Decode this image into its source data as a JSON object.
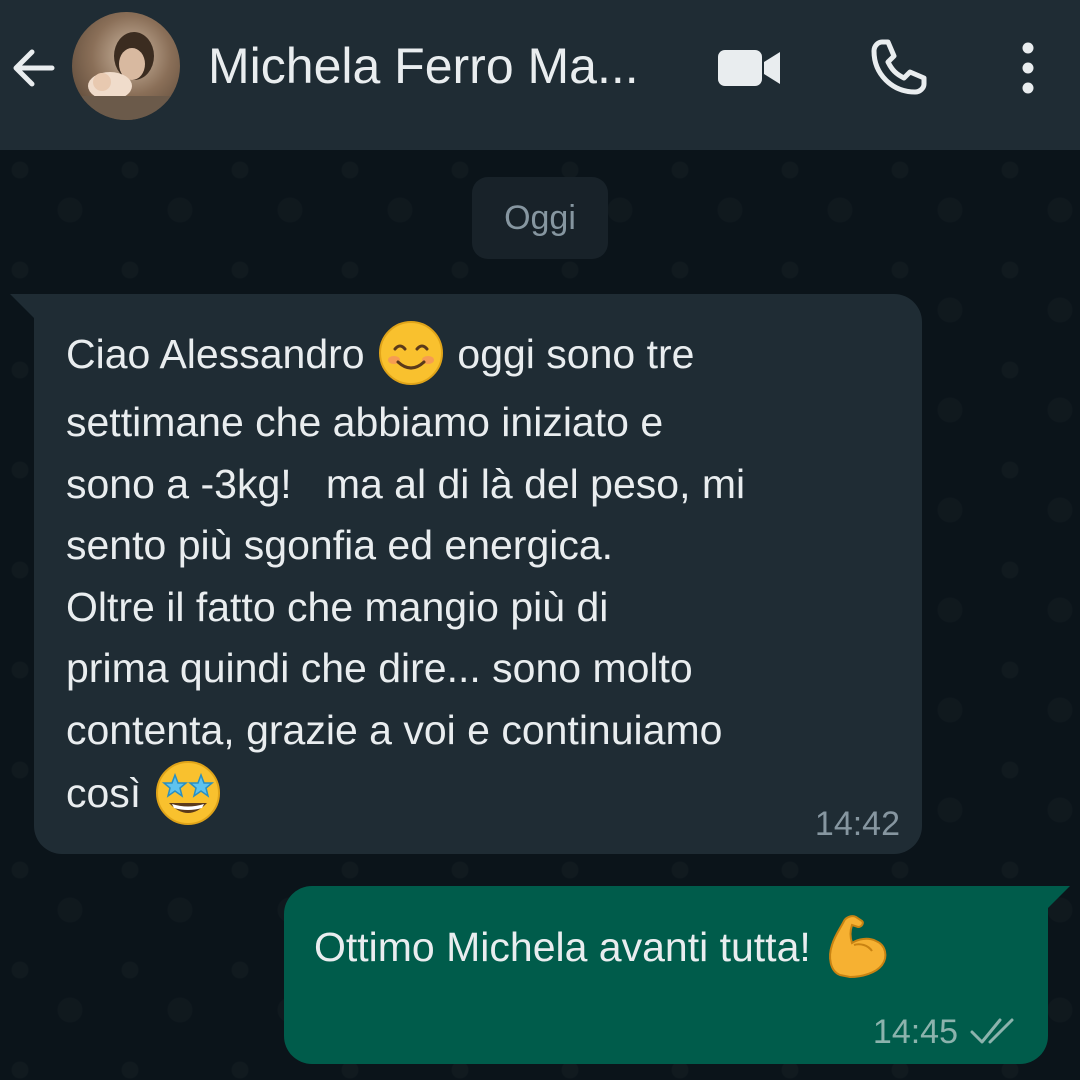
{
  "header": {
    "contact_name": "Michela Ferro Ma...",
    "icons": [
      "back-arrow-icon",
      "video-call-icon",
      "phone-icon",
      "more-vert-icon"
    ]
  },
  "date_chip": "Oggi",
  "messages": [
    {
      "direction": "incoming",
      "lines": [
        "Ciao Alessandro",
        "oggi sono tre",
        "settimane che abbiamo iniziato e",
        "sono a -3kg!   ma al di là del peso, mi",
        "sento più sgonfia ed energica.",
        "Oltre il fatto che mangio più di",
        "prima quindi che dire... sono molto",
        "contenta, grazie a voi e continuiamo",
        "così"
      ],
      "emojis": [
        "smiling-face-icon",
        "star-struck-icon"
      ],
      "time": "14:42"
    },
    {
      "direction": "outgoing",
      "text": "Ottimo Michela avanti tutta!",
      "emojis": [
        "flexed-biceps-icon"
      ],
      "time": "14:45",
      "status": "read"
    }
  ],
  "colors": {
    "header_bg": "#1f2c34",
    "chat_bg": "#0b141a",
    "incoming_bubble": "#1f2c34",
    "outgoing_bubble": "#005c4b",
    "text": "#e9edef",
    "meta_text": "#8696a0"
  }
}
